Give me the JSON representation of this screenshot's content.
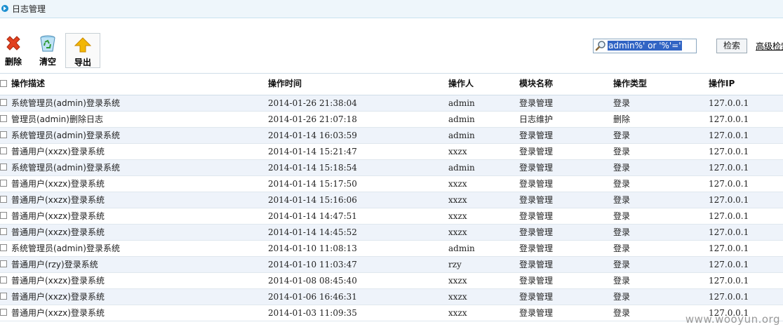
{
  "page": {
    "title": "日志管理"
  },
  "toolbar": {
    "delete_label": "删除",
    "clear_label": "清空",
    "export_label": "导出"
  },
  "search": {
    "value": "admin%' or '%'='",
    "button_label": "检索",
    "advanced_label": "高级检索"
  },
  "table": {
    "headers": [
      "操作描述",
      "操作时间",
      "操作人",
      "模块名称",
      "操作类型",
      "操作IP"
    ],
    "rows": [
      [
        "系统管理员(admin)登录系统",
        "2014-01-26 21:38:04",
        "admin",
        "登录管理",
        "登录",
        "127.0.0.1"
      ],
      [
        "管理员(admin)删除日志",
        "2014-01-26 21:07:18",
        "admin",
        "日志维护",
        "删除",
        "127.0.0.1"
      ],
      [
        "系统管理员(admin)登录系统",
        "2014-01-14 16:03:59",
        "admin",
        "登录管理",
        "登录",
        "127.0.0.1"
      ],
      [
        "普通用户(xxzx)登录系统",
        "2014-01-14 15:21:47",
        "xxzx",
        "登录管理",
        "登录",
        "127.0.0.1"
      ],
      [
        "系统管理员(admin)登录系统",
        "2014-01-14 15:18:54",
        "admin",
        "登录管理",
        "登录",
        "127.0.0.1"
      ],
      [
        "普通用户(xxzx)登录系统",
        "2014-01-14 15:17:50",
        "xxzx",
        "登录管理",
        "登录",
        "127.0.0.1"
      ],
      [
        "普通用户(xxzx)登录系统",
        "2014-01-14 15:16:06",
        "xxzx",
        "登录管理",
        "登录",
        "127.0.0.1"
      ],
      [
        "普通用户(xxzx)登录系统",
        "2014-01-14 14:47:51",
        "xxzx",
        "登录管理",
        "登录",
        "127.0.0.1"
      ],
      [
        "普通用户(xxzx)登录系统",
        "2014-01-14 14:45:52",
        "xxzx",
        "登录管理",
        "登录",
        "127.0.0.1"
      ],
      [
        "系统管理员(admin)登录系统",
        "2014-01-10 11:08:13",
        "admin",
        "登录管理",
        "登录",
        "127.0.0.1"
      ],
      [
        "普通用户(rzy)登录系统",
        "2014-01-10 11:03:47",
        "rzy",
        "登录管理",
        "登录",
        "127.0.0.1"
      ],
      [
        "普通用户(xxzx)登录系统",
        "2014-01-08 08:45:40",
        "xxzx",
        "登录管理",
        "登录",
        "127.0.0.1"
      ],
      [
        "普通用户(xxzx)登录系统",
        "2014-01-06 16:46:31",
        "xxzx",
        "登录管理",
        "登录",
        "127.0.0.1"
      ],
      [
        "普通用户(xxzx)登录系统",
        "2014-01-03 11:09:35",
        "xxzx",
        "登录管理",
        "登录",
        "127.0.0.1"
      ]
    ]
  },
  "watermark": "www.wooyun.org",
  "colors": {
    "title_bar_bg": "#eef6fb",
    "row_alt_bg": "#eef3fa",
    "selection_bg": "#3164c4",
    "delete_red": "#e2401f",
    "export_yellow": "#f2b705"
  },
  "icons": {
    "title": "circle-arrow-icon",
    "delete": "red-x-icon",
    "clear": "recycle-bin-icon",
    "export": "up-arrow-icon",
    "search": "magnifier-icon"
  }
}
